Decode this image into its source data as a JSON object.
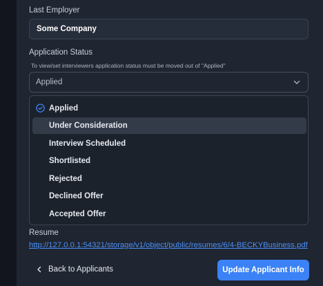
{
  "last_employer": {
    "label": "Last Employer",
    "value": "Some Company"
  },
  "application_status": {
    "label": "Application Status",
    "hint": "To view/set interviewers application status must be moved out of \"Applied\"",
    "selected": "Applied",
    "options": [
      {
        "label": "Applied",
        "checked": true
      },
      {
        "label": "Under Consideration",
        "highlighted": true
      },
      {
        "label": "Interview Scheduled"
      },
      {
        "label": "Shortlisted"
      },
      {
        "label": "Rejected"
      },
      {
        "label": "Declined Offer"
      },
      {
        "label": "Accepted Offer"
      }
    ]
  },
  "resume": {
    "label": "Resume",
    "link": "http://127.0.0.1:54321/storage/v1/object/public/resumes/6/4-BECKYBusiness.pdf"
  },
  "actions": {
    "back_label": "Back to Applicants",
    "update_label": "Update Applicant Info"
  },
  "colors": {
    "accent": "#3b82f6",
    "link": "#4b8ff6",
    "panel_bg": "#1f2531"
  },
  "icons": {
    "select_chevron": "chevron-down-icon",
    "selected_option": "check-circle-icon",
    "back": "chevron-left-icon"
  }
}
